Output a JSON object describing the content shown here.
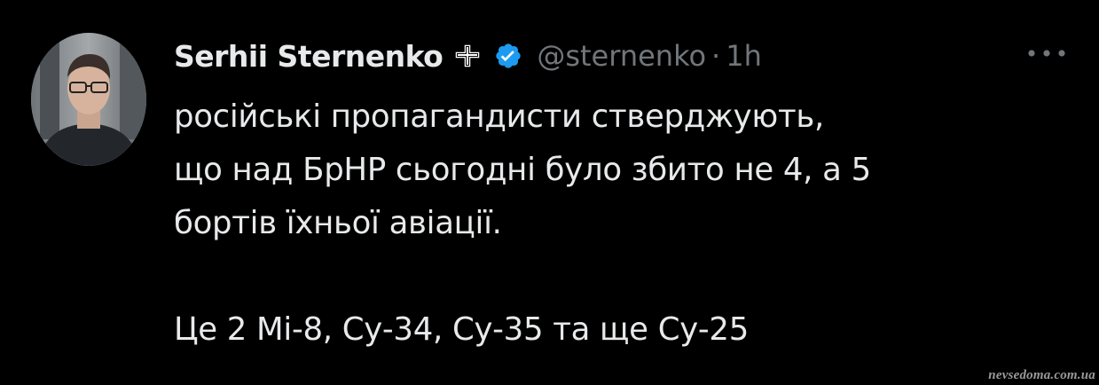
{
  "tweet": {
    "author": {
      "display_name": "Serhii Sternenko",
      "handle": "@sternenko",
      "avatar_icon": "avatar-photo-icon",
      "badge_icons": [
        "cross-flag-icon",
        "verified-badge-icon"
      ],
      "verified_color": "#1d9bf0"
    },
    "separator": "·",
    "timestamp": "1h",
    "more_icon": "more-options-icon",
    "text_lines": [
      "російські пропагандисти стверджують,",
      "що над БрНР сьогодні було збито не 4, а 5",
      "бортів їхньої авіації."
    ],
    "text_line_final": "Це 2 Мі-8, Су-34, Су-35 та ще Су-25"
  },
  "watermark": "nevsedoma.com.ua",
  "colors": {
    "background": "#000000",
    "primary_text": "#e7e9ea",
    "secondary_text": "#71767b"
  }
}
